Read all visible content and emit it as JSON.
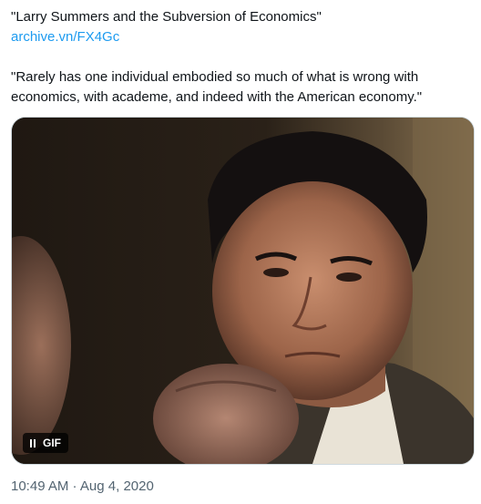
{
  "tweet": {
    "title_line": "\"Larry Summers and the Subversion of Economics\"",
    "link_text": "archive.vn/FX4Gc",
    "body_line1": "\"Rarely has one individual embodied so much of what is wrong with",
    "body_line2": "economics, with academe, and indeed with the American economy.\"",
    "media": {
      "badge_label": "GIF",
      "badge_icon": "pause-icon"
    },
    "time": "10:49 AM",
    "separator": " · ",
    "date": "Aug 4, 2020"
  },
  "colors": {
    "text": "#0f1419",
    "link": "#1d9bf0",
    "muted": "#536471",
    "border": "#cfd9de"
  }
}
